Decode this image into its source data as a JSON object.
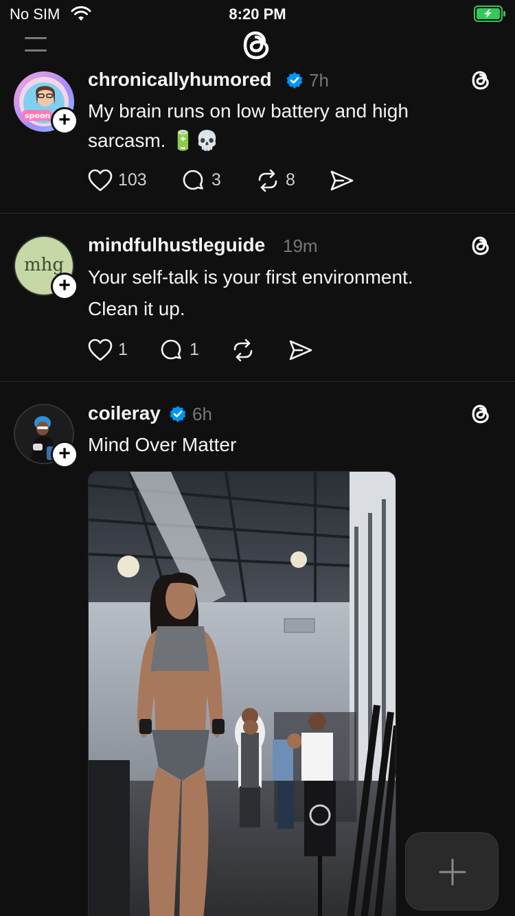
{
  "status_bar": {
    "carrier": "No SIM",
    "time": "8:20 PM",
    "battery_color": "#34c759"
  },
  "nav": {
    "logo_icon": "threads-logo-icon",
    "menu_icon": "menu-icon"
  },
  "posts": [
    {
      "username": "chronicallyhumored",
      "verified": true,
      "time": "7h",
      "text_line1": "My brain runs on low battery and high",
      "text_line2": "sarcasm. 🔋💀",
      "likes": "103",
      "replies": "3",
      "reposts": "8",
      "avatar_sticker_text": "spoon"
    },
    {
      "username": "mindfulhustleguide",
      "verified": false,
      "time": "19m",
      "text_line1": "Your self-talk is your first environment.",
      "text_line2": "Clean it up.",
      "likes": "1",
      "replies": "1",
      "avatar_text": "mhg"
    },
    {
      "username": "coileray",
      "verified": true,
      "time": "6h",
      "text_line1": "Mind Over Matter"
    }
  ],
  "colors": {
    "background": "#101010",
    "verified": "#0095f6",
    "muted": "#777777"
  }
}
